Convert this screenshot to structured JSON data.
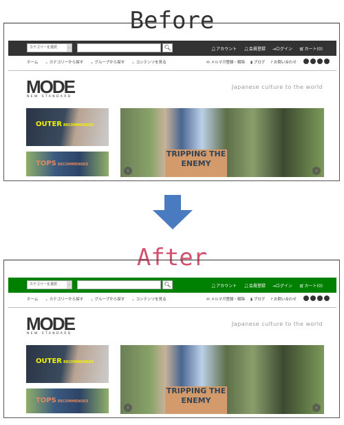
{
  "before": {
    "title": "Before",
    "title_color": "#333333",
    "bar_color": "#333333"
  },
  "after": {
    "title": "After",
    "title_color": "#d4506e",
    "bar_color": "#008000"
  },
  "arrow_color": "#4a7abf",
  "site": {
    "category_select": "カテゴリーを選択",
    "search_placeholder": "",
    "account": "アカウント",
    "register": "会員登録",
    "login": "ログイン",
    "cart": "カート(0)",
    "nav": [
      "ホーム",
      "カテゴリーから探す",
      "グループから探す",
      "コンテンツを見る"
    ],
    "nav_right": [
      "メルマガ登録・解除",
      "ブログ",
      "お問い合わせ"
    ],
    "social": [
      "twitter-icon",
      "facebook-icon",
      "google-plus-icon",
      "pinterest-icon"
    ],
    "logo": "MODE",
    "logo_sub": "NEW STANDARD",
    "tagline": "Japanese culture to the world",
    "banner1": {
      "title": "OUTER",
      "sub": "RECOMMENDED"
    },
    "banner2": {
      "title": "TOPS",
      "sub": "RECOMMENDED"
    },
    "slide_text": "TRIPPING THE ENEMY"
  }
}
